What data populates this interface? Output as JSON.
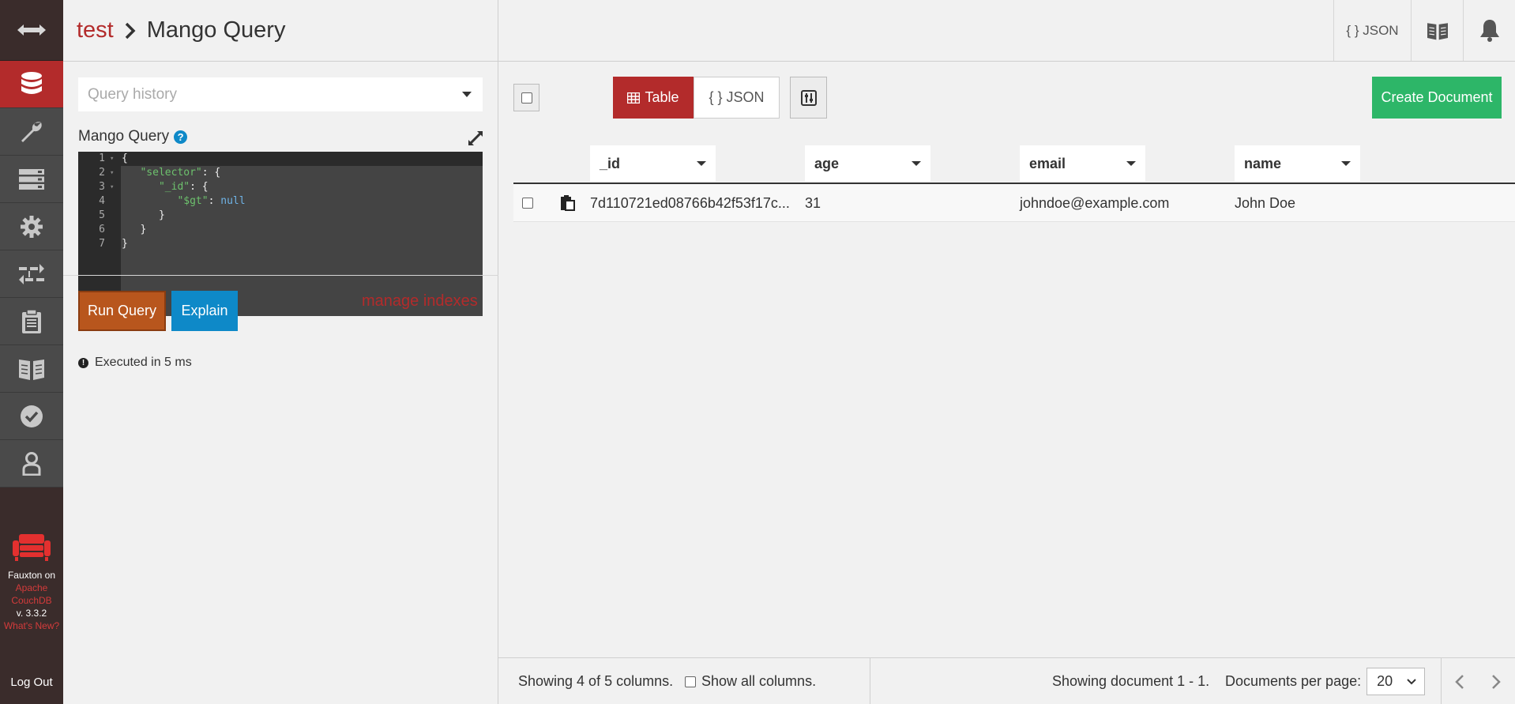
{
  "sidebar": {
    "footer_line1": "Fauxton on",
    "footer_line2": "Apache",
    "footer_line3": "CouchDB",
    "footer_version": "v. 3.3.2",
    "footer_whats_new": "What's New?",
    "logout": "Log Out"
  },
  "header": {
    "db_name": "test",
    "page_title": "Mango Query",
    "json_button": "{ } JSON"
  },
  "query": {
    "history_placeholder": "Query history",
    "editor_label": "Mango Query",
    "help_glyph": "?",
    "code_lines": [
      {
        "num": "1",
        "text": "{"
      },
      {
        "num": "2",
        "key": "\"selector\"",
        "rest": ": {"
      },
      {
        "num": "3",
        "key": "\"_id\"",
        "rest": ": {"
      },
      {
        "num": "4",
        "key": "\"$gt\"",
        "rest": ": ",
        "val": "null"
      },
      {
        "num": "5",
        "text": "}"
      },
      {
        "num": "6",
        "text": "}"
      },
      {
        "num": "7",
        "text": "}"
      }
    ],
    "run_button": "Run Query",
    "explain_button": "Explain",
    "manage_indexes": "manage indexes",
    "executed": "Executed in 5 ms"
  },
  "results": {
    "view_table": "Table",
    "view_json": "{ } JSON",
    "create_document": "Create Document",
    "columns": [
      "_id",
      "age",
      "email",
      "name"
    ],
    "rows": [
      {
        "_id": "7d110721ed08766b42f53f17c...",
        "age": "31",
        "email": "johndoe@example.com",
        "name": "John Doe"
      }
    ],
    "footer": {
      "showing_columns": "Showing 4 of 5 columns.",
      "show_all": "Show all columns.",
      "showing_docs": "Showing document 1 - 1.",
      "per_page_label": "Documents per page:",
      "per_page_value": "20"
    }
  },
  "colors": {
    "brand_red": "#b32b2b",
    "run_orange": "#b8561d",
    "explain_blue": "#0e89c8",
    "create_green": "#2db668",
    "sidebar_dark": "#3a2c2b"
  }
}
